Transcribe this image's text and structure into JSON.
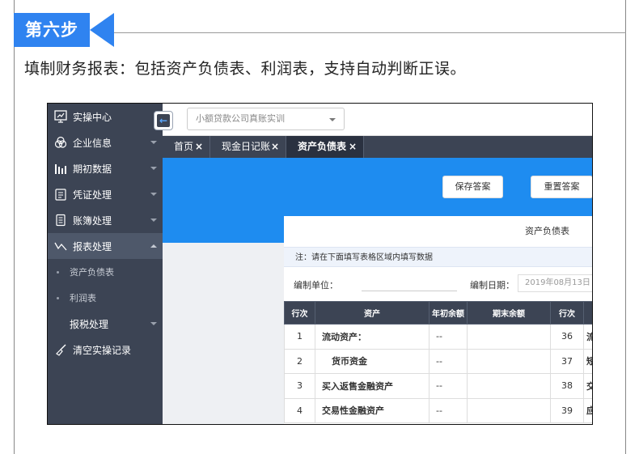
{
  "step": {
    "badge": "第六步",
    "description": "填制财务报表：包括资产负债表、利润表，支持自动判断正误。"
  },
  "sidebar": {
    "items": [
      {
        "label": "实操中心",
        "icon": "presentation-icon"
      },
      {
        "label": "企业信息",
        "icon": "cube-icon"
      },
      {
        "label": "期初数据",
        "icon": "bar-chart-icon"
      },
      {
        "label": "凭证处理",
        "icon": "voucher-icon"
      },
      {
        "label": "账簿处理",
        "icon": "ledger-icon"
      },
      {
        "label": "报表处理",
        "icon": "line-chart-icon"
      },
      {
        "label": "资产负债表"
      },
      {
        "label": "利润表"
      },
      {
        "label": "报税处理"
      },
      {
        "label": "清空实操记录",
        "icon": "broom-icon"
      }
    ]
  },
  "toggle": {
    "icon": "←"
  },
  "header": {
    "company_select": "小额贷款公司真账实训"
  },
  "tabs": [
    {
      "label": "首页",
      "close": "×"
    },
    {
      "label": "现金日记账",
      "close": "×"
    },
    {
      "label": "资产负债表",
      "close": "×"
    }
  ],
  "actions": {
    "save": "保存答案",
    "reset": "重置答案"
  },
  "report": {
    "title": "资产负债表",
    "note": "注：请在下面填写表格区域内填写数据",
    "unit_label": "编制单位：",
    "date_label": "编制日期：",
    "date_value": "2019年08月13日"
  },
  "table": {
    "headers": [
      "行次",
      "资产",
      "年初余额",
      "期末余额",
      "行次",
      ""
    ],
    "rows": [
      {
        "line": "1",
        "name": "流动资产：",
        "begin": "--",
        "end": "",
        "line2": "36",
        "right": "流"
      },
      {
        "line": "2",
        "name": "货币资金",
        "begin": "--",
        "end": "",
        "line2": "37",
        "right": "短"
      },
      {
        "line": "3",
        "name": "买入返售金融资产",
        "begin": "--",
        "end": "",
        "line2": "38",
        "right": "交"
      },
      {
        "line": "4",
        "name": "交易性金融资产",
        "begin": "--",
        "end": "",
        "line2": "39",
        "right": "应"
      }
    ]
  },
  "colors": {
    "accent": "#2f83f0",
    "sidebar": "#3c4454",
    "banner": "#1e8cf0"
  }
}
